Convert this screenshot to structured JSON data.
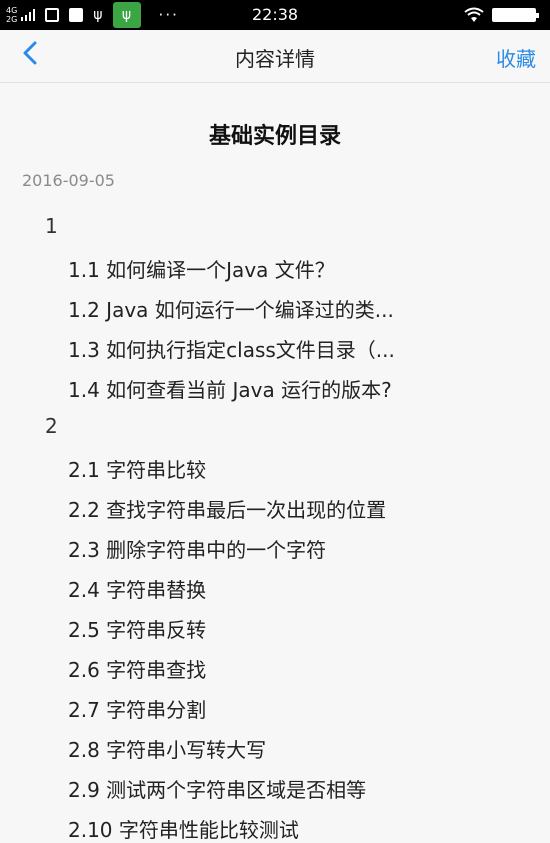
{
  "status_bar": {
    "network_top": "4G",
    "network_bottom": "2G",
    "more": "···",
    "time": "22:38"
  },
  "nav": {
    "back_icon": "chevron-left-icon",
    "title": "内容详情",
    "favorite_label": "收藏"
  },
  "article": {
    "title": "基础实例目录",
    "date": "2016-09-05",
    "sections": [
      {
        "label": "1",
        "items": [
          "1.1 如何编译一个Java 文件？",
          "1.2 Java 如何运行一个编译过的类...",
          "1.3 如何执行指定class文件目录（...",
          "1.4 如何查看当前 Java 运行的版本?"
        ]
      },
      {
        "label": "2",
        "items": [
          "2.1 字符串比较",
          "2.2 查找字符串最后一次出现的位置",
          "2.3 删除字符串中的一个字符",
          "2.4 字符串替换",
          "2.5 字符串反转",
          "2.6 字符串查找",
          "2.7 字符串分割",
          "2.8 字符串小写转大写",
          "2.9 测试两个字符串区域是否相等",
          "2.10 字符串性能比较测试"
        ]
      }
    ]
  },
  "colors": {
    "accent": "#2a8be6",
    "status_bar_bg": "#000000",
    "page_bg": "#f7f7f7",
    "date_text": "#8a8a8a"
  }
}
